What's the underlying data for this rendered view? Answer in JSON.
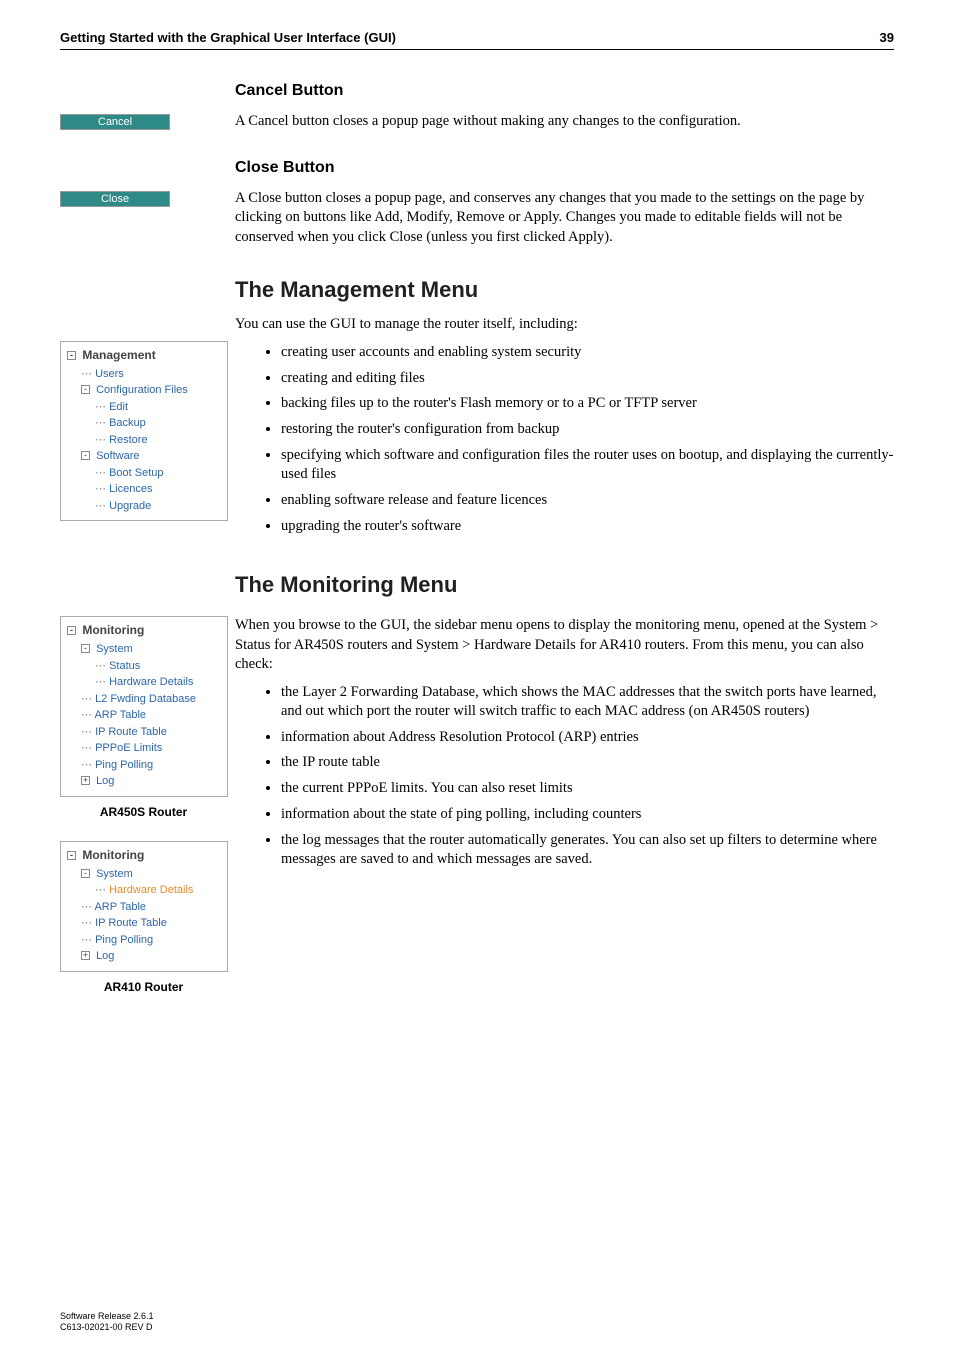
{
  "header": {
    "title": "Getting Started with the Graphical User Interface (GUI)",
    "page": "39"
  },
  "cancel": {
    "heading": "Cancel Button",
    "btn": "Cancel",
    "para": "A Cancel button closes a popup page without making any changes to the configuration."
  },
  "close": {
    "heading": "Close Button",
    "btn": "Close",
    "para": "A Close button closes a popup page, and conserves any changes that you made to the settings on the page by clicking on buttons like Add, Modify, Remove or Apply. Changes you made to editable fields will not be conserved when you click Close (unless you first clicked Apply)."
  },
  "mgmt": {
    "heading": "The Management Menu",
    "intro": "You can use the GUI to manage the router itself, including:",
    "bullets": [
      "creating user accounts and enabling system security",
      "creating and editing files",
      "backing files up to the router's Flash memory or to a PC or TFTP server",
      "restoring the router's configuration from backup",
      "specifying which software and configuration files the router uses on bootup, and displaying the currently-used files",
      "enabling software release and feature licences",
      "upgrading the router's software"
    ],
    "tree": {
      "title": "Management",
      "users": "Users",
      "config": "Configuration Files",
      "edit": "Edit",
      "backup": "Backup",
      "restore": "Restore",
      "software": "Software",
      "boot": "Boot Setup",
      "licences": "Licences",
      "upgrade": "Upgrade"
    }
  },
  "mon": {
    "heading": "The Monitoring Menu",
    "intro": "When you browse to the GUI, the sidebar menu opens to display the monitoring menu, opened at the System > Status for AR450S routers and System > Hardware Details for AR410 routers. From this menu, you can also check:",
    "bullets": [
      "the Layer 2 Forwarding Database, which shows the MAC addresses that the switch ports have learned, and out which port the router will switch traffic to each MAC address (on AR450S routers)",
      "information about Address Resolution Protocol (ARP) entries",
      "the IP route table",
      "the current PPPoE limits. You can also reset limits",
      "information about the state of ping polling, including counters",
      "the log messages that the router automatically generates. You can also set up filters to determine where messages are saved to and which messages are saved."
    ],
    "tree450": {
      "title": "Monitoring",
      "system": "System",
      "status": "Status",
      "hw": "Hardware Details",
      "l2": "L2 Fwding Database",
      "arp": "ARP Table",
      "ip": "IP Route Table",
      "pppoe": "PPPoE Limits",
      "ping": "Ping Polling",
      "log": "Log",
      "caption": "AR450S Router"
    },
    "tree410": {
      "title": "Monitoring",
      "system": "System",
      "hw": "Hardware Details",
      "arp": "ARP Table",
      "ip": "IP Route Table",
      "ping": "Ping Polling",
      "log": "Log",
      "caption": "AR410 Router"
    }
  },
  "footer": {
    "line1": "Software Release 2.6.1",
    "line2": "C613-02021-00 REV D"
  }
}
